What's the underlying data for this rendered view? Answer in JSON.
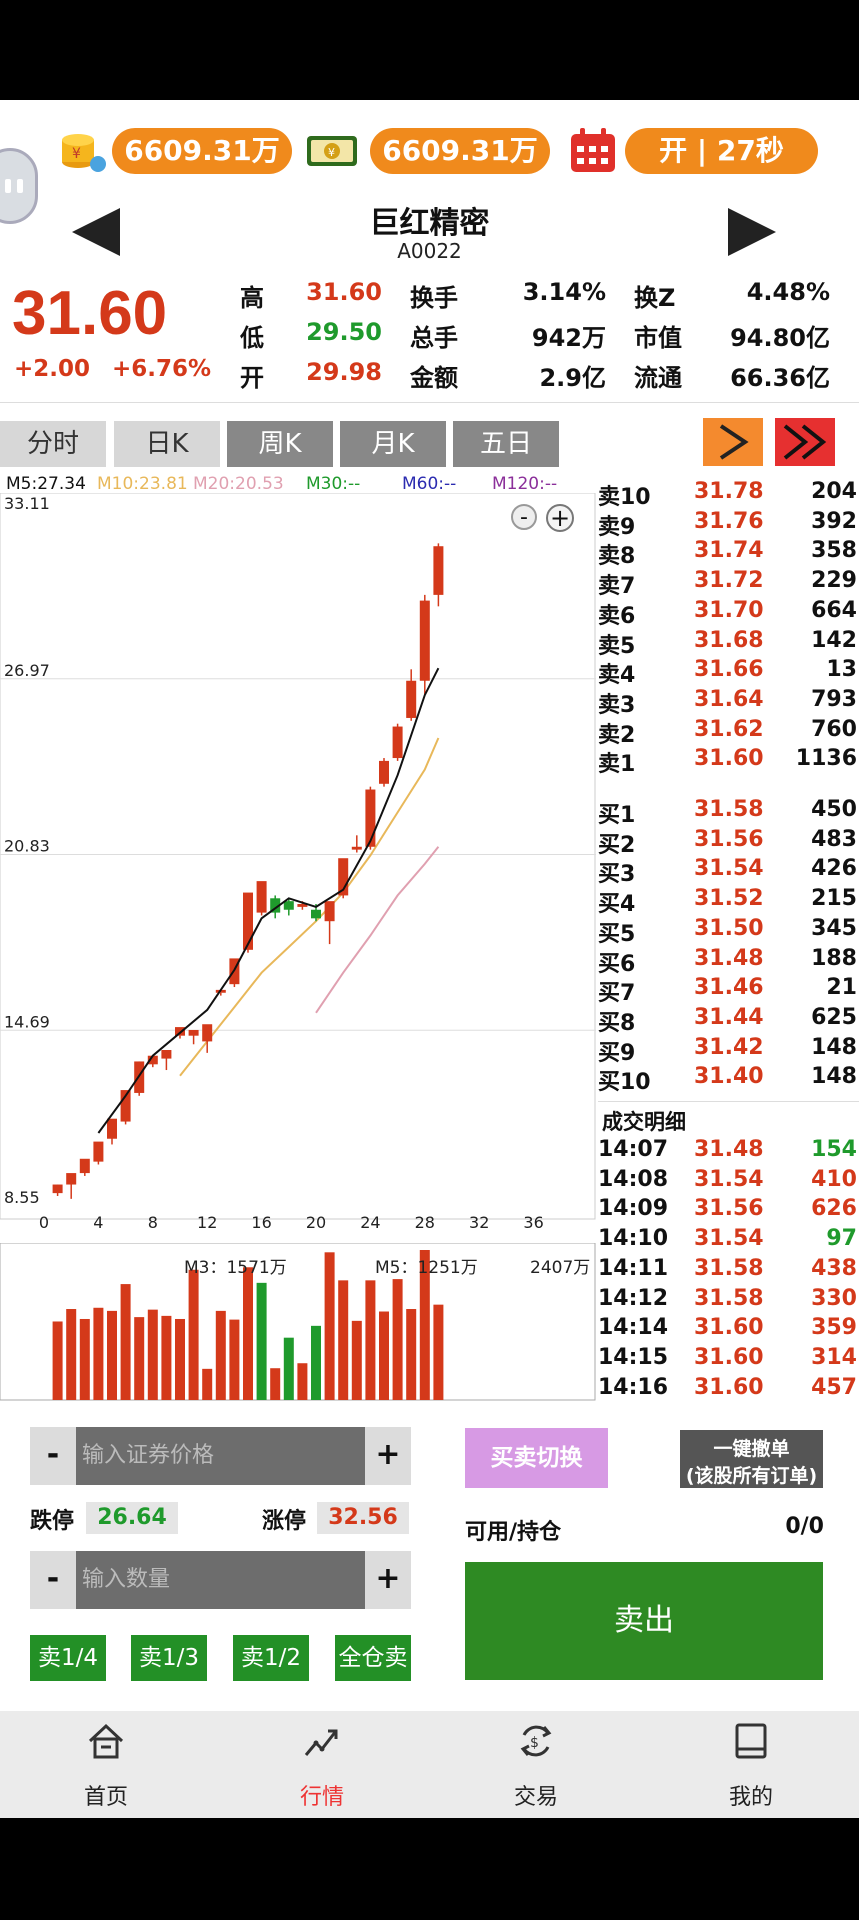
{
  "header": {
    "balance1": "6609.31万",
    "balance2": "6609.31万",
    "market_status": "开 | 27秒"
  },
  "stock": {
    "name": "巨红精密",
    "code": "A0022",
    "price": "31.60",
    "change": "+2.00",
    "change_pct": "+6.76%"
  },
  "quote": {
    "high_label": "高",
    "high": "31.60",
    "low_label": "低",
    "low": "29.50",
    "open_label": "开",
    "open": "29.98",
    "turnover_label": "换手",
    "turnover": "3.14%",
    "total_hands_label": "总手",
    "total_hands": "942万",
    "amount_label": "金额",
    "amount": "2.9亿",
    "turnz_label": "换Z",
    "turnz": "4.48%",
    "mktcap_label": "市值",
    "mktcap": "94.80亿",
    "float_label": "流通",
    "float": "66.36亿"
  },
  "period_tabs": [
    "分时",
    "日K",
    "周K",
    "月K",
    "五日"
  ],
  "ma": {
    "m5": "M5:27.34",
    "m10": "M10:23.81",
    "m20": "M20:20.53",
    "m30": "M30:--",
    "m60": "M60:--",
    "m120": "M120:--"
  },
  "zoom": {
    "minus": "-",
    "plus": "+"
  },
  "colors": {
    "up": "#d4391a",
    "down": "#1f9a2c",
    "ma5": "#111111",
    "ma10": "#e8b85a",
    "ma20": "#e0a0b0"
  },
  "chart_data": {
    "type": "candlestick",
    "y_ticks": [
      "33.11",
      "26.97",
      "20.83",
      "14.69",
      "8.55"
    ],
    "ylim": [
      8.55,
      33.11
    ],
    "x_ticks": [
      "0",
      "4",
      "8",
      "12",
      "16",
      "20",
      "24",
      "28",
      "32",
      "36"
    ],
    "xlim": [
      0,
      40
    ],
    "candles": [
      [
        1,
        9.0,
        9.3,
        8.9,
        9.3
      ],
      [
        2,
        9.3,
        9.7,
        8.8,
        9.6
      ],
      [
        3,
        9.7,
        10.2,
        9.6,
        10.1
      ],
      [
        4,
        10.1,
        10.8,
        10.0,
        10.7
      ],
      [
        5,
        10.9,
        11.6,
        10.7,
        11.5
      ],
      [
        6,
        11.5,
        12.6,
        11.4,
        12.5
      ],
      [
        7,
        12.5,
        13.6,
        12.4,
        13.6
      ],
      [
        8,
        13.5,
        13.8,
        13.4,
        13.7
      ],
      [
        9,
        13.7,
        14.0,
        13.3,
        13.9
      ],
      [
        10,
        14.5,
        14.8,
        14.4,
        14.5
      ],
      [
        11,
        14.5,
        14.7,
        14.2,
        14.6
      ],
      [
        12,
        14.3,
        14.9,
        13.9,
        14.6
      ],
      [
        13,
        16.0,
        16.1,
        15.9,
        16.0
      ],
      [
        14,
        16.3,
        17.2,
        16.2,
        17.0
      ],
      [
        15,
        17.5,
        19.5,
        17.4,
        19.4
      ],
      [
        16,
        18.8,
        19.9,
        18.7,
        19.5
      ],
      [
        17,
        19.3,
        18.8,
        18.6,
        19.4
      ],
      [
        18,
        19.2,
        18.9,
        18.7,
        19.3
      ],
      [
        19,
        19.0,
        19.1,
        18.9,
        19.2
      ],
      [
        20,
        18.9,
        18.6,
        18.5,
        19.1
      ],
      [
        21,
        18.5,
        19.2,
        17.7,
        19.0
      ],
      [
        22,
        19.4,
        20.7,
        19.3,
        20.6
      ],
      [
        23,
        21.0,
        21.1,
        20.9,
        21.5
      ],
      [
        24,
        21.1,
        23.1,
        21.0,
        23.2
      ],
      [
        25,
        23.3,
        24.1,
        23.2,
        24.2
      ],
      [
        26,
        24.2,
        25.3,
        24.1,
        25.4
      ],
      [
        27,
        25.6,
        26.9,
        25.5,
        27.3
      ],
      [
        28,
        26.9,
        29.7,
        26.4,
        29.9
      ],
      [
        29,
        29.9,
        31.6,
        29.5,
        31.7
      ]
    ],
    "ma5": [
      [
        4,
        11.1
      ],
      [
        6,
        12.4
      ],
      [
        8,
        13.8
      ],
      [
        10,
        14.6
      ],
      [
        12,
        15.4
      ],
      [
        14,
        16.8
      ],
      [
        16,
        18.6
      ],
      [
        18,
        19.3
      ],
      [
        20,
        19.0
      ],
      [
        22,
        19.6
      ],
      [
        24,
        21.3
      ],
      [
        26,
        23.6
      ],
      [
        28,
        26.4
      ],
      [
        29,
        27.34
      ]
    ],
    "ma10": [
      [
        10,
        13.1
      ],
      [
        12,
        14.3
      ],
      [
        14,
        15.5
      ],
      [
        16,
        16.7
      ],
      [
        18,
        17.6
      ],
      [
        20,
        18.5
      ],
      [
        22,
        19.5
      ],
      [
        24,
        20.8
      ],
      [
        26,
        22.3
      ],
      [
        28,
        23.8
      ],
      [
        29,
        24.9
      ]
    ],
    "ma20": [
      [
        20,
        15.3
      ],
      [
        22,
        16.7
      ],
      [
        24,
        18.0
      ],
      [
        26,
        19.4
      ],
      [
        28,
        20.5
      ],
      [
        29,
        21.1
      ]
    ]
  },
  "volume_chart": {
    "m3": "M3：1571万",
    "m5": "M5：1251万",
    "max": "2407万",
    "bars": [
      [
        1,
        1260,
        "up"
      ],
      [
        2,
        1460,
        "up"
      ],
      [
        3,
        1300,
        "up"
      ],
      [
        4,
        1480,
        "up"
      ],
      [
        5,
        1430,
        "up"
      ],
      [
        6,
        1860,
        "up"
      ],
      [
        7,
        1330,
        "up"
      ],
      [
        8,
        1450,
        "up"
      ],
      [
        9,
        1350,
        "up"
      ],
      [
        10,
        1300,
        "up"
      ],
      [
        11,
        2090,
        "up"
      ],
      [
        12,
        500,
        "up"
      ],
      [
        13,
        1430,
        "up"
      ],
      [
        14,
        1290,
        "up"
      ],
      [
        15,
        2130,
        "up"
      ],
      [
        16,
        1880,
        "down"
      ],
      [
        17,
        510,
        "up"
      ],
      [
        18,
        1000,
        "down"
      ],
      [
        19,
        590,
        "up"
      ],
      [
        20,
        1190,
        "down"
      ],
      [
        21,
        2370,
        "up"
      ],
      [
        22,
        1920,
        "up"
      ],
      [
        23,
        1270,
        "up"
      ],
      [
        24,
        1920,
        "up"
      ],
      [
        25,
        1420,
        "up"
      ],
      [
        26,
        1940,
        "up"
      ],
      [
        27,
        1460,
        "up"
      ],
      [
        28,
        2407,
        "up"
      ],
      [
        29,
        1530,
        "up"
      ]
    ]
  },
  "order_book": {
    "sells": [
      {
        "label": "卖10",
        "price": "31.78",
        "vol": "204"
      },
      {
        "label": "卖9",
        "price": "31.76",
        "vol": "392"
      },
      {
        "label": "卖8",
        "price": "31.74",
        "vol": "358"
      },
      {
        "label": "卖7",
        "price": "31.72",
        "vol": "229"
      },
      {
        "label": "卖6",
        "price": "31.70",
        "vol": "664"
      },
      {
        "label": "卖5",
        "price": "31.68",
        "vol": "142"
      },
      {
        "label": "卖4",
        "price": "31.66",
        "vol": "13"
      },
      {
        "label": "卖3",
        "price": "31.64",
        "vol": "793"
      },
      {
        "label": "卖2",
        "price": "31.62",
        "vol": "760"
      },
      {
        "label": "卖1",
        "price": "31.60",
        "vol": "1136"
      }
    ],
    "buys": [
      {
        "label": "买1",
        "price": "31.58",
        "vol": "450"
      },
      {
        "label": "买2",
        "price": "31.56",
        "vol": "483"
      },
      {
        "label": "买3",
        "price": "31.54",
        "vol": "426"
      },
      {
        "label": "买4",
        "price": "31.52",
        "vol": "215"
      },
      {
        "label": "买5",
        "price": "31.50",
        "vol": "345"
      },
      {
        "label": "买6",
        "price": "31.48",
        "vol": "188"
      },
      {
        "label": "买7",
        "price": "31.46",
        "vol": "21"
      },
      {
        "label": "买8",
        "price": "31.44",
        "vol": "625"
      },
      {
        "label": "买9",
        "price": "31.42",
        "vol": "148"
      },
      {
        "label": "买10",
        "price": "31.40",
        "vol": "148"
      }
    ]
  },
  "trades": {
    "title": "成交明细",
    "rows": [
      {
        "time": "14:07",
        "price": "31.48",
        "vol": "154",
        "dir": "down"
      },
      {
        "time": "14:08",
        "price": "31.54",
        "vol": "410",
        "dir": "up"
      },
      {
        "time": "14:09",
        "price": "31.56",
        "vol": "626",
        "dir": "up"
      },
      {
        "time": "14:10",
        "price": "31.54",
        "vol": "97",
        "dir": "down"
      },
      {
        "time": "14:11",
        "price": "31.58",
        "vol": "438",
        "dir": "up"
      },
      {
        "time": "14:12",
        "price": "31.58",
        "vol": "330",
        "dir": "up"
      },
      {
        "time": "14:14",
        "price": "31.60",
        "vol": "359",
        "dir": "up"
      },
      {
        "time": "14:15",
        "price": "31.60",
        "vol": "314",
        "dir": "up"
      },
      {
        "time": "14:16",
        "price": "31.60",
        "vol": "457",
        "dir": "up"
      }
    ]
  },
  "trade_panel": {
    "minus": "-",
    "plus": "+",
    "price_placeholder": "输入证券价格",
    "qty_placeholder": "输入数量",
    "limit_down_label": "跌停",
    "limit_down": "26.64",
    "limit_up_label": "涨停",
    "limit_up": "32.56",
    "switch_label": "买卖切换",
    "cancel_all_line1": "一键撤单",
    "cancel_all_line2": "(该股所有订单)",
    "available_label": "可用/持仓",
    "available_value": "0/0",
    "sell_label": "卖出",
    "fractions": [
      "卖1/4",
      "卖1/3",
      "卖1/2",
      "全仓卖"
    ]
  },
  "bottom_nav": [
    {
      "label": "首页",
      "icon": "home-icon"
    },
    {
      "label": "行情",
      "icon": "chart-trend-icon"
    },
    {
      "label": "交易",
      "icon": "exchange-icon"
    },
    {
      "label": "我的",
      "icon": "book-icon"
    }
  ]
}
